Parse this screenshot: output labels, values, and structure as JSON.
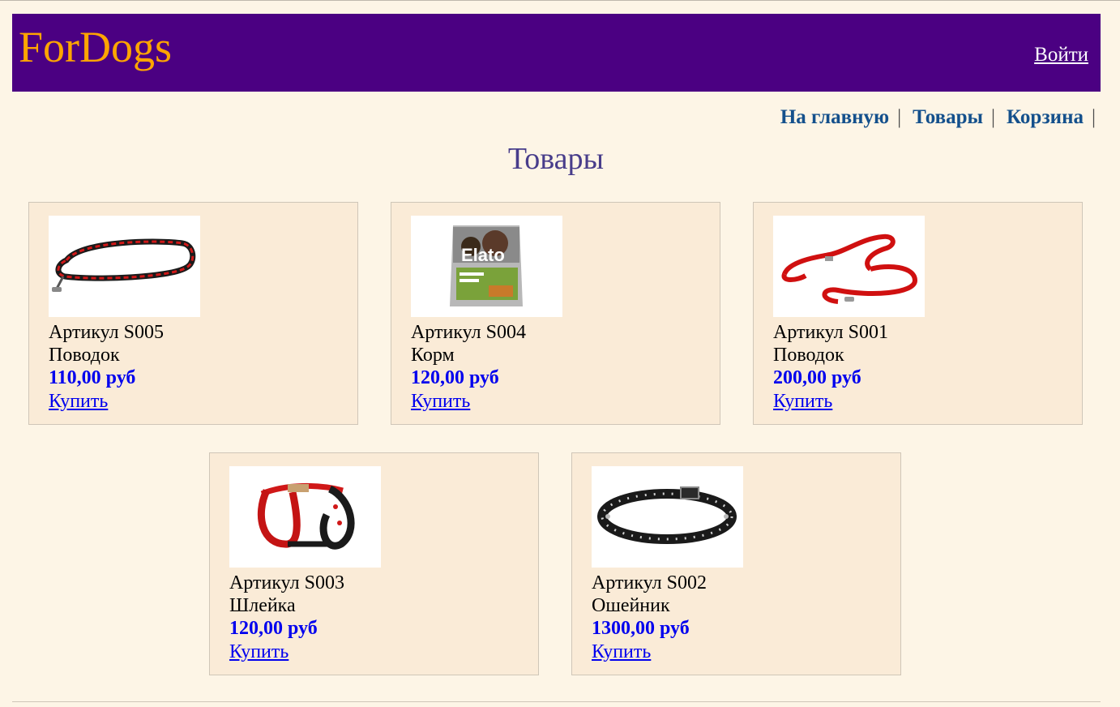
{
  "header": {
    "logo": "ForDogs",
    "login_label": "Войти",
    "background_color": "#4b0082",
    "logo_color": "#ffa500"
  },
  "nav": {
    "items": [
      {
        "label": "На главную"
      },
      {
        "label": "Товары"
      },
      {
        "label": "Корзина"
      }
    ],
    "separator": "|"
  },
  "page": {
    "title": "Товары"
  },
  "products": [
    {
      "sku": "Артикул S005",
      "name": "Поводок",
      "price": "110,00 руб",
      "buy_label": "Купить",
      "image_icon": "red-black-leash-image"
    },
    {
      "sku": "Артикул S004",
      "name": "Корм",
      "price": "120,00 руб",
      "buy_label": "Купить",
      "image_icon": "dog-food-bag-image",
      "image_text": "Elato"
    },
    {
      "sku": "Артикул S001",
      "name": "Поводок",
      "price": "200,00 руб",
      "buy_label": "Купить",
      "image_icon": "red-leash-image"
    },
    {
      "sku": "Артикул S003",
      "name": "Шлейка",
      "price": "120,00 руб",
      "buy_label": "Купить",
      "image_icon": "dog-harness-image"
    },
    {
      "sku": "Артикул S002",
      "name": "Ошейник",
      "price": "1300,00 руб",
      "buy_label": "Купить",
      "image_icon": "spiked-collar-image"
    }
  ]
}
